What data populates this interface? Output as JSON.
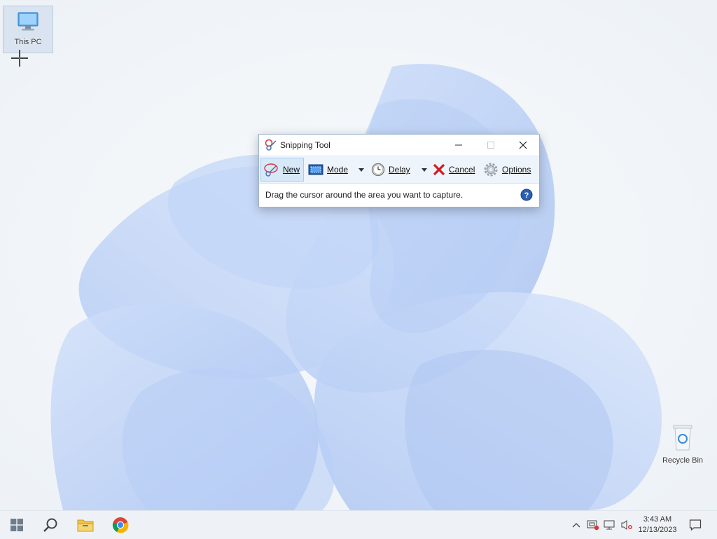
{
  "desktop": {
    "icons": [
      {
        "label": "This PC"
      },
      {
        "label": "Recycle Bin"
      }
    ]
  },
  "snipping_tool": {
    "title": "Snipping Tool",
    "toolbar": {
      "new_label": "New",
      "mode_label": "Mode",
      "delay_label": "Delay",
      "cancel_label": "Cancel",
      "options_label": "Options"
    },
    "status_text": "Drag the cursor around the area you want to capture."
  },
  "taskbar": {
    "time": "3:43 AM",
    "date": "12/13/2023"
  },
  "colors": {
    "accent": "#1a73d0",
    "wallpaper_blue": "#7aa5f0",
    "cancel_red": "#d11a1a"
  },
  "icons": [
    "windows-start-icon",
    "search-icon",
    "file-explorer-icon",
    "chrome-icon",
    "chevron-up-icon",
    "network-icon",
    "monitor-icon",
    "speaker-muted-icon",
    "notification-icon",
    "help-icon"
  ]
}
